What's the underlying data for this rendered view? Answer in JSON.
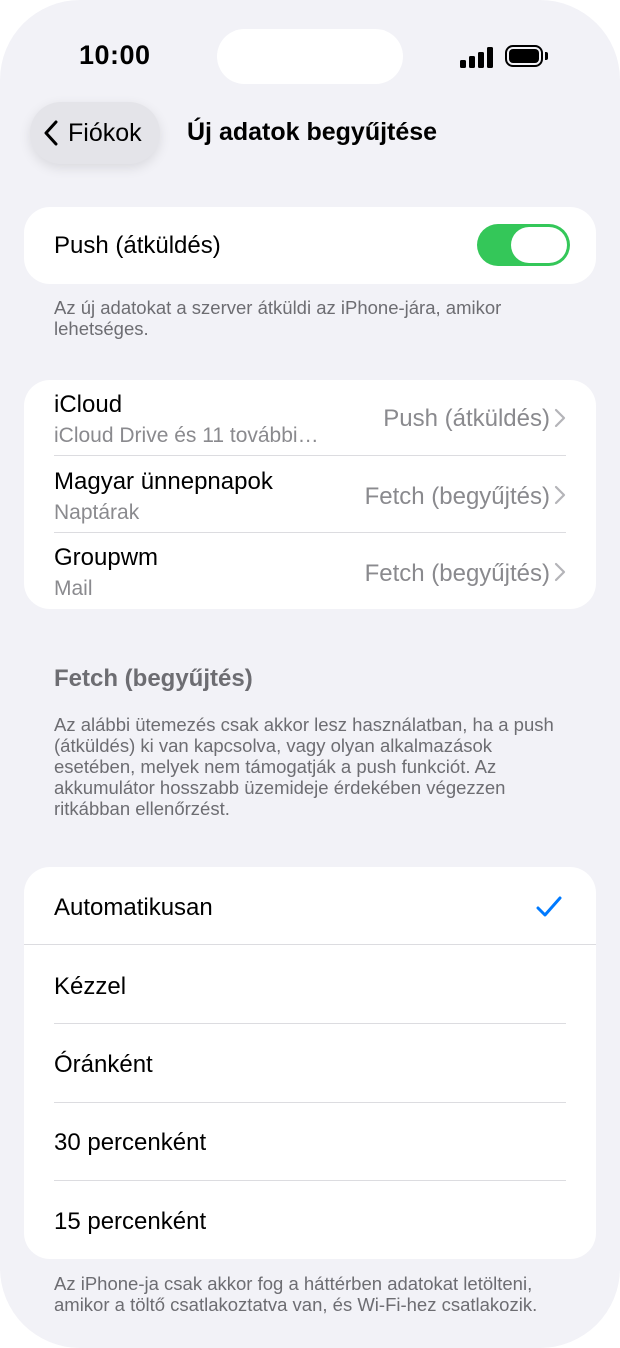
{
  "status_bar": {
    "time": "10:00"
  },
  "nav": {
    "back_label": "Fiókok",
    "title": "Új adatok begyűjtése"
  },
  "push": {
    "label": "Push (átküldés)",
    "enabled": true,
    "footnote": "Az új adatokat a szerver átküldi az iPhone-jára, amikor lehetséges."
  },
  "accounts": [
    {
      "name": "iCloud",
      "detail": "iCloud Drive és 11 további…",
      "value": "Push (átküldés)"
    },
    {
      "name": "Magyar ünnepnapok",
      "detail": "Naptárak",
      "value": "Fetch (begyűjtés)"
    },
    {
      "name": "Groupwm",
      "detail": "Mail",
      "value": "Fetch (begyűjtés)"
    }
  ],
  "fetch": {
    "title": "Fetch (begyűjtés)",
    "description": "Az alábbi ütemezés csak akkor lesz használatban, ha a push (átküldés) ki van kapcsolva, vagy olyan alkalmazások esetében, melyek nem támogatják a push funkciót. Az akkumulátor hosszabb üzemideje érdekében végezzen ritkábban ellenőrzést.",
    "options": [
      "Automatikusan",
      "Kézzel",
      "Óránként",
      "30 percenként",
      "15 percenként"
    ],
    "selected": "Automatikusan",
    "footnote": "Az iPhone-ja csak akkor fog a háttérben adatokat letölteni, amikor a töltő csatlakoztatva van, és Wi-Fi-hez csatlakozik."
  },
  "colors": {
    "toggle_on": "#34c759",
    "accent": "#007aff",
    "background": "#f2f2f7"
  }
}
